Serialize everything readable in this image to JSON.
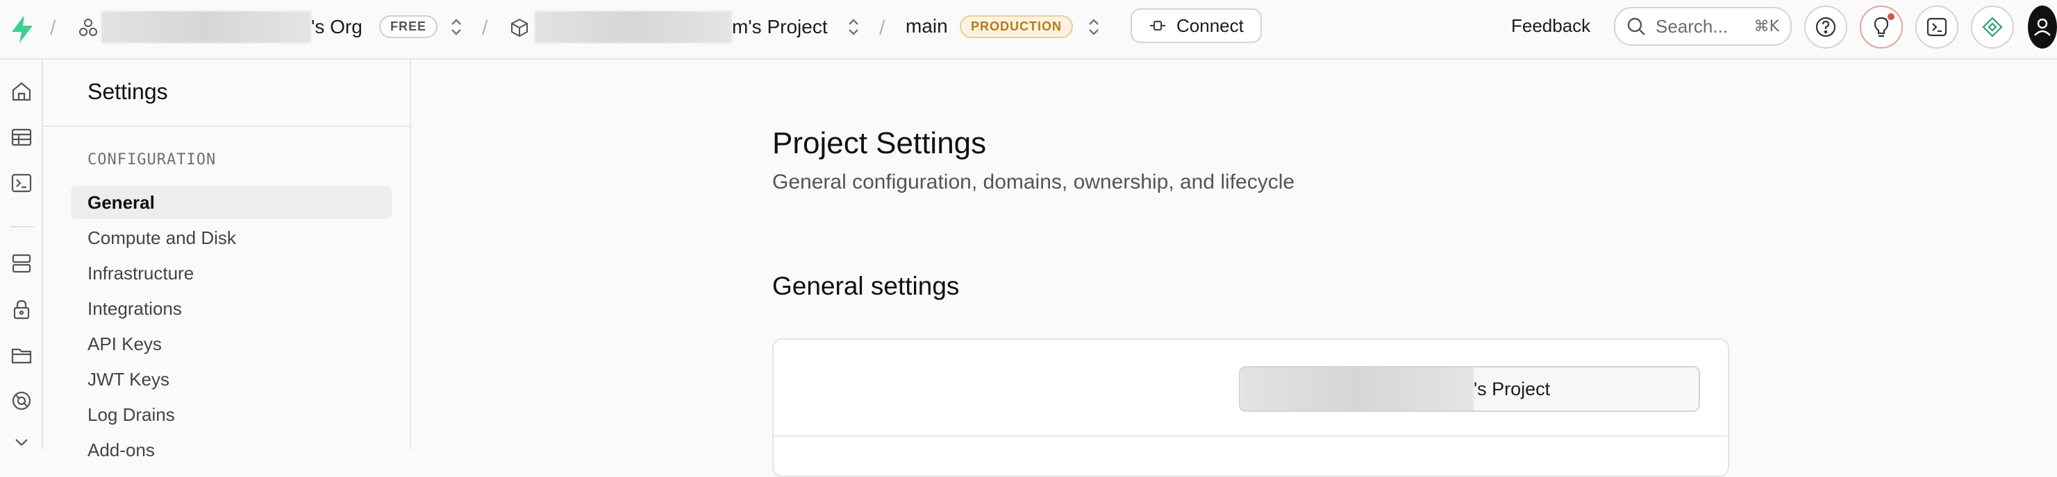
{
  "topbar": {
    "org_name_suffix": "'s Org",
    "org_plan": "FREE",
    "project_name_suffix": "m's Project",
    "branch": "main",
    "environment": "PRODUCTION",
    "connect_label": "Connect",
    "feedback_label": "Feedback",
    "search_placeholder": "Search...",
    "search_shortcut": "⌘K"
  },
  "icons": {
    "brand": "bolt-logo-icon",
    "org": "org-icon",
    "project": "cube-icon",
    "connect": "plug-icon",
    "search": "search-icon",
    "help": "help-icon",
    "tips": "lightbulb-icon",
    "terminal": "terminal-icon",
    "assistant": "diamond-icon",
    "avatar": "avatar-icon"
  },
  "sidebar": {
    "title": "Settings",
    "section_label": "CONFIGURATION",
    "items": [
      {
        "label": "General",
        "active": true
      },
      {
        "label": "Compute and Disk"
      },
      {
        "label": "Infrastructure"
      },
      {
        "label": "Integrations"
      },
      {
        "label": "API Keys"
      },
      {
        "label": "JWT Keys"
      },
      {
        "label": "Log Drains"
      },
      {
        "label": "Add-ons"
      }
    ]
  },
  "main": {
    "title": "Project Settings",
    "subtitle": "General configuration, domains, ownership, and lifecycle",
    "section_title": "General settings",
    "project_name_value_suffix": "'s Project"
  },
  "colors": {
    "brand": "#3ecf8e",
    "production_text": "#b7791f",
    "notification_dot": "#d9534f"
  }
}
